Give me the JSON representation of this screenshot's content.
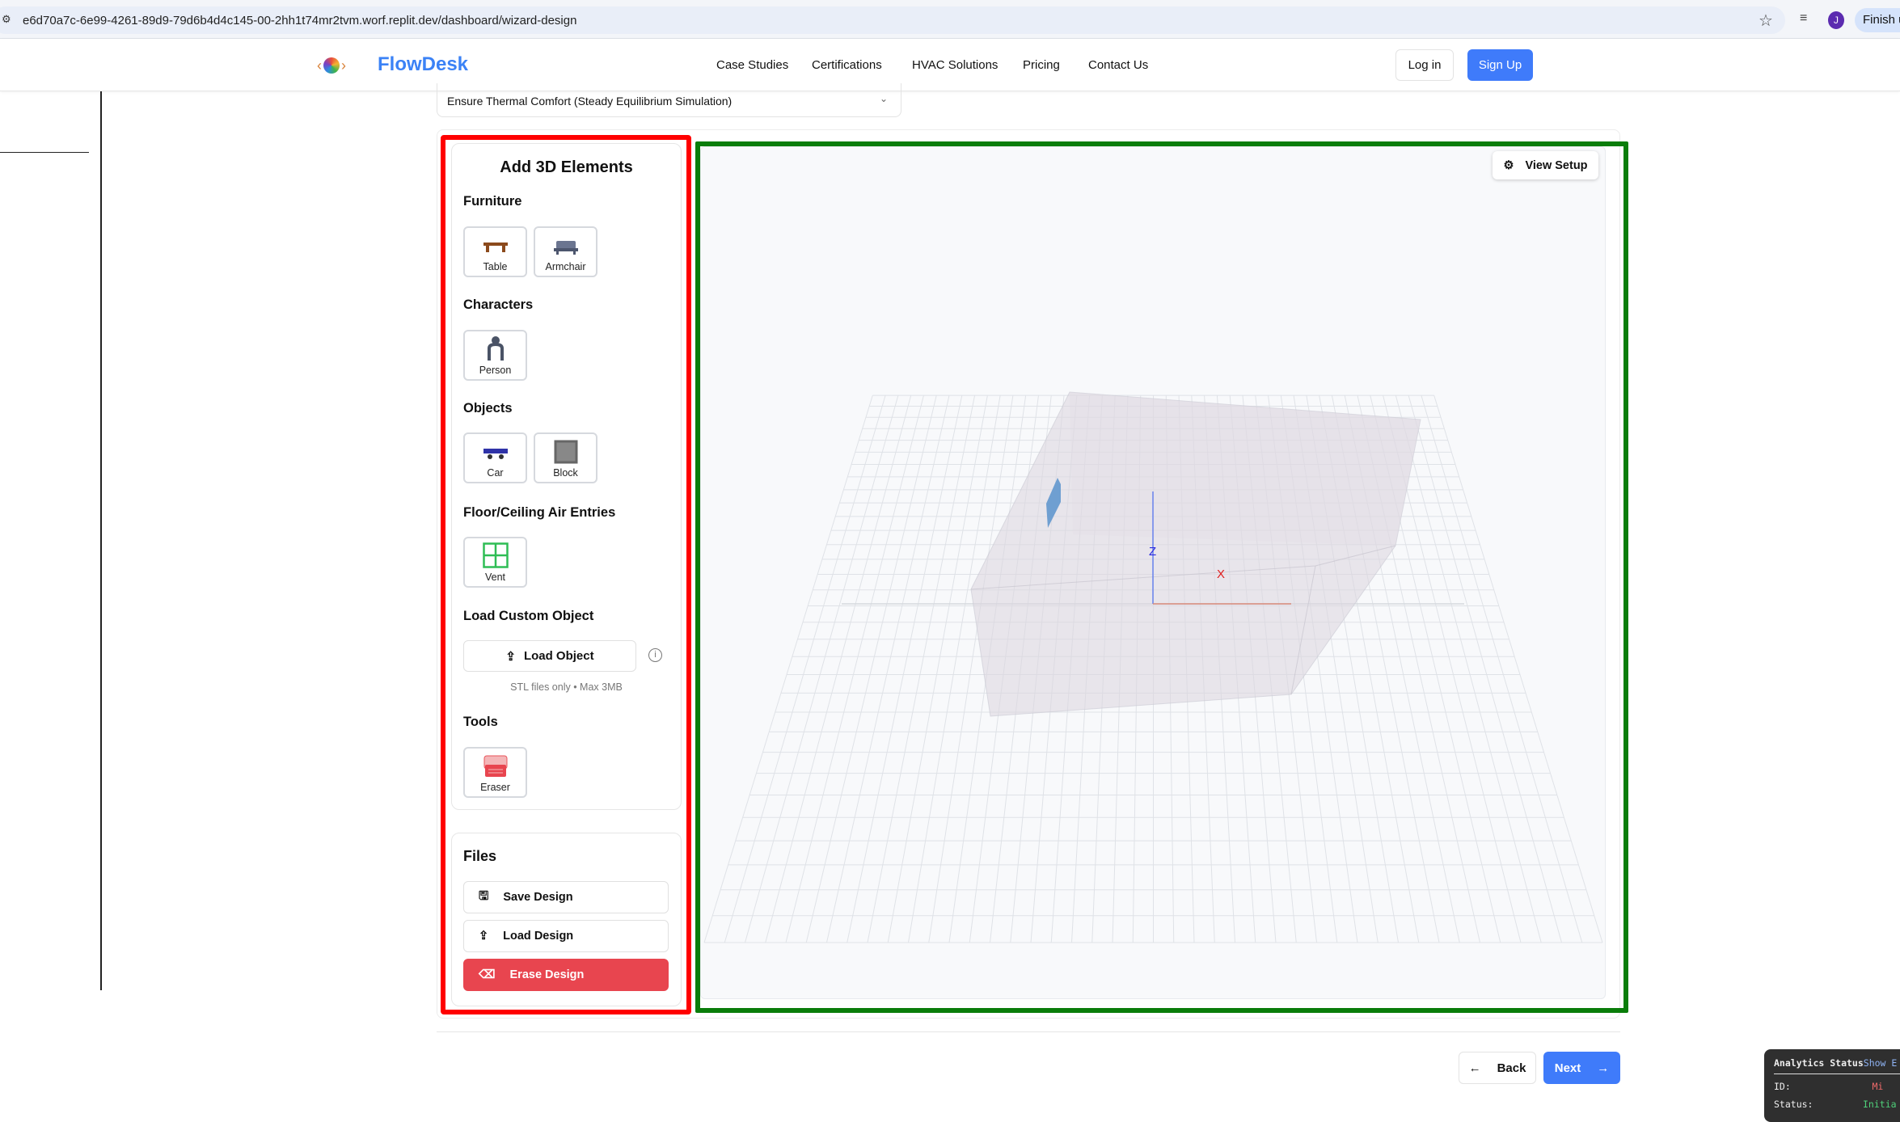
{
  "browser": {
    "url": "e6d70a7c-6e99-4261-89d9-79d6b4d4c145-00-2hh1t74mr2tvm.worf.replit.dev/dashboard/wizard-design",
    "avatar": "J",
    "finish_label": "Finish u"
  },
  "nav": {
    "brand": "FlowDesk",
    "links": [
      "Case Studies",
      "Certifications",
      "HVAC Solutions",
      "Pricing",
      "Contact Us"
    ],
    "login": "Log in",
    "signup": "Sign Up"
  },
  "simulation_select": {
    "value": "Ensure Thermal Comfort (Steady Equilibrium Simulation)"
  },
  "elements_panel": {
    "title": "Add 3D Elements",
    "furniture": {
      "label": "Furniture",
      "items": [
        "Table",
        "Armchair"
      ]
    },
    "characters": {
      "label": "Characters",
      "items": [
        "Person"
      ]
    },
    "objects": {
      "label": "Objects",
      "items": [
        "Car",
        "Block"
      ]
    },
    "air_entries": {
      "label": "Floor/Ceiling Air Entries",
      "items": [
        "Vent"
      ]
    },
    "custom": {
      "label": "Load Custom Object",
      "button": "Load Object",
      "hint": "STL files only • Max 3MB"
    },
    "tools": {
      "label": "Tools",
      "items": [
        "Eraser"
      ]
    }
  },
  "files_panel": {
    "title": "Files",
    "save": "Save Design",
    "load": "Load Design",
    "erase": "Erase Design"
  },
  "viewport": {
    "view_setup": "View Setup",
    "axis_x": "X",
    "axis_z": "Z"
  },
  "footer": {
    "back": "Back",
    "next": "Next"
  },
  "analytics": {
    "title": "Analytics Status",
    "toggle": "Show E",
    "id_label": "ID:",
    "id_value": "Mi",
    "status_label": "Status:",
    "status_value": "Initia"
  },
  "colors": {
    "accent": "#3f7bfa",
    "danger": "#e8454f",
    "highlight_red": "#ff0000",
    "highlight_green": "#0a7d0a"
  }
}
